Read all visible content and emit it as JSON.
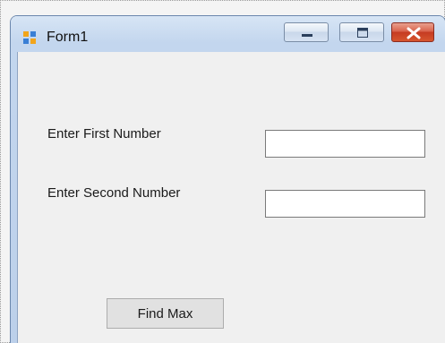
{
  "window": {
    "title": "Form1",
    "icons": {
      "app": "form-icon",
      "minimize": "minimize-icon",
      "maximize": "maximize-icon",
      "close": "close-icon"
    },
    "colors": {
      "close_button": "#c53b22",
      "client_background": "#f0f0f0"
    }
  },
  "form": {
    "first_label": "Enter First Number",
    "first_value": "",
    "second_label": "Enter Second Number",
    "second_value": "",
    "button_label": "Find Max"
  }
}
